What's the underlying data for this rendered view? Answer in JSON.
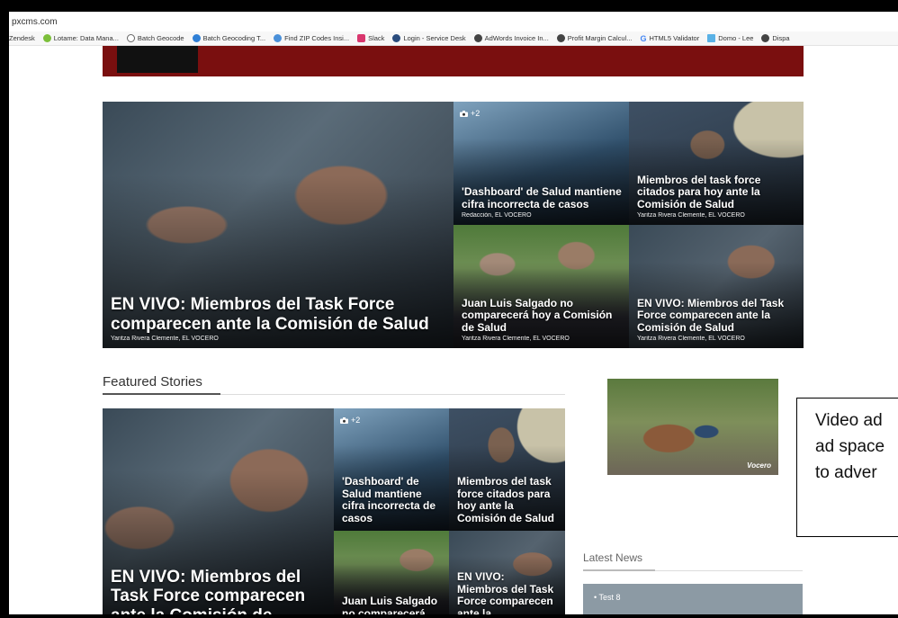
{
  "browser": {
    "url": "pxcms.com",
    "bookmarks": [
      {
        "label": "Zendesk"
      },
      {
        "label": "Lotame: Data Mana..."
      },
      {
        "label": "Batch Geocode"
      },
      {
        "label": "Batch Geocoding T..."
      },
      {
        "label": "Find ZIP Codes Insi..."
      },
      {
        "label": "Slack"
      },
      {
        "label": "Login - Service Desk"
      },
      {
        "label": "AdWords Invoice In..."
      },
      {
        "label": "Profit Margin Calcul..."
      },
      {
        "label": "HTML5 Validator"
      },
      {
        "label": "Domo - Lee"
      },
      {
        "label": "Dispa"
      }
    ]
  },
  "top_grid": {
    "main": {
      "headline": "EN VIVO: Miembros del Task Force comparecen ante la Comisión de Salud",
      "byline": "Yaritza Rivera Clemente, EL VOCERO"
    },
    "tile1": {
      "headline": "'Dashboard' de Salud mantiene cifra incorrecta de casos",
      "byline": "Redacción, EL VOCERO",
      "photo_count": "+2"
    },
    "tile2": {
      "headline": "Miembros del task force citados para hoy ante la Comisión de Salud",
      "byline": "Yaritza Rivera Clemente, EL VOCERO"
    },
    "tile3": {
      "headline": "Juan Luis Salgado no comparecerá hoy a Comisión de Salud",
      "byline": "Yaritza Rivera Clemente, EL VOCERO"
    },
    "tile4": {
      "headline": "EN VIVO: Miembros del Task Force comparecen ante la Comisión de Salud",
      "byline": "Yaritza Rivera Clemente, EL VOCERO"
    }
  },
  "featured": {
    "title": "Featured Stories",
    "main": {
      "headline": "EN VIVO: Miembros del Task Force comparecen ante la Comisión de"
    },
    "tile1": {
      "headline": "'Dashboard' de Salud mantiene cifra incorrecta de casos",
      "photo_count": "+2"
    },
    "tile2": {
      "headline": "Miembros del task force citados para hoy ante la Comisión de Salud"
    },
    "tile3": {
      "headline": "Juan Luis Salgado no comparecerá"
    },
    "tile4": {
      "headline": "EN VIVO: Miembros del Task Force comparecen ante la"
    }
  },
  "video": {
    "brand": "Vocero"
  },
  "annotation": {
    "line1": "Video ad",
    "line2": "ad space",
    "line3": "to adver"
  },
  "latest": {
    "title": "Latest News",
    "item1": "Test 8"
  }
}
